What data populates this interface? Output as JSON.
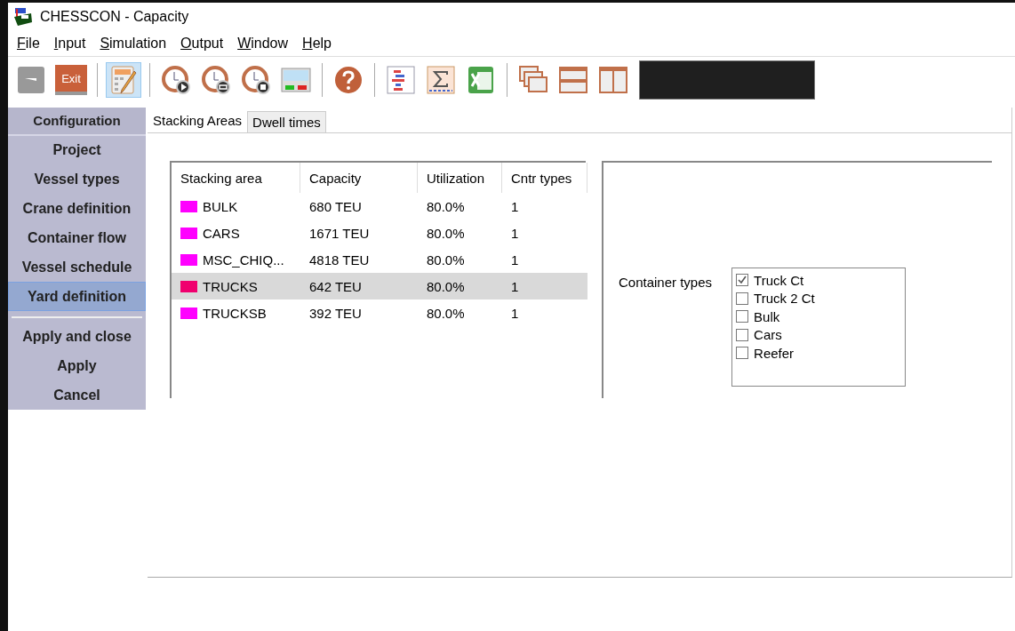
{
  "window": {
    "title": "CHESSCON - Capacity"
  },
  "menu": [
    {
      "label": "File"
    },
    {
      "label": "Input"
    },
    {
      "label": "Simulation"
    },
    {
      "label": "Output"
    },
    {
      "label": "Window"
    },
    {
      "label": "Help"
    }
  ],
  "toolbar": [
    {
      "kind": "back",
      "selected": false
    },
    {
      "kind": "exit",
      "label": "Exit",
      "selected": false
    },
    {
      "kind": "sep"
    },
    {
      "kind": "calc",
      "selected": true
    },
    {
      "kind": "sep"
    },
    {
      "kind": "clock-play",
      "selected": false
    },
    {
      "kind": "clock-loop",
      "selected": false
    },
    {
      "kind": "clock-stop",
      "selected": false
    },
    {
      "kind": "screen",
      "selected": false
    },
    {
      "kind": "sep"
    },
    {
      "kind": "help",
      "selected": false
    },
    {
      "kind": "sep"
    },
    {
      "kind": "gantt",
      "selected": false
    },
    {
      "kind": "sigma",
      "selected": false
    },
    {
      "kind": "sheet",
      "selected": false
    },
    {
      "kind": "sep"
    },
    {
      "kind": "cascade",
      "selected": false
    },
    {
      "kind": "hsplit",
      "selected": false
    },
    {
      "kind": "vsplit",
      "selected": false
    },
    {
      "kind": "dark"
    }
  ],
  "sidebar": {
    "header": "Configuration",
    "items": [
      {
        "label": "Project",
        "selected": false
      },
      {
        "label": "Vessel types",
        "selected": false
      },
      {
        "label": "Crane definition",
        "selected": false
      },
      {
        "label": "Container flow",
        "selected": false
      },
      {
        "label": "Vessel schedule",
        "selected": false
      },
      {
        "label": "Yard definition",
        "selected": true
      }
    ],
    "actions": [
      "Apply and close",
      "Apply",
      "Cancel"
    ]
  },
  "tabs": [
    {
      "label": "Stacking Areas",
      "selected": true
    },
    {
      "label": "Dwell times",
      "selected": false
    }
  ],
  "table": {
    "columns": [
      "Stacking area",
      "Capacity",
      "Utilization",
      "Cntr types"
    ],
    "rows": [
      {
        "name": "BULK",
        "color": "#ff00ff",
        "capacity": "680 TEU",
        "utilization": "80.0%",
        "types": "1",
        "selected": false
      },
      {
        "name": "CARS",
        "color": "#ff00ff",
        "capacity": "1671 TEU",
        "utilization": "80.0%",
        "types": "1",
        "selected": false
      },
      {
        "name": "MSC_CHIQ...",
        "color": "#ff00ff",
        "capacity": "4818 TEU",
        "utilization": "80.0%",
        "types": "1",
        "selected": false
      },
      {
        "name": "TRUCKS",
        "color": "#f0006e",
        "capacity": "642 TEU",
        "utilization": "80.0%",
        "types": "1",
        "selected": true
      },
      {
        "name": "TRUCKSB",
        "color": "#ff00ff",
        "capacity": "392 TEU",
        "utilization": "80.0%",
        "types": "1",
        "selected": false
      }
    ]
  },
  "container_types": {
    "label": "Container types",
    "items": [
      {
        "label": "Truck Ct",
        "checked": true
      },
      {
        "label": "Truck 2 Ct",
        "checked": false
      },
      {
        "label": "Bulk",
        "checked": false
      },
      {
        "label": "Cars",
        "checked": false
      },
      {
        "label": "Reefer",
        "checked": false
      }
    ]
  }
}
